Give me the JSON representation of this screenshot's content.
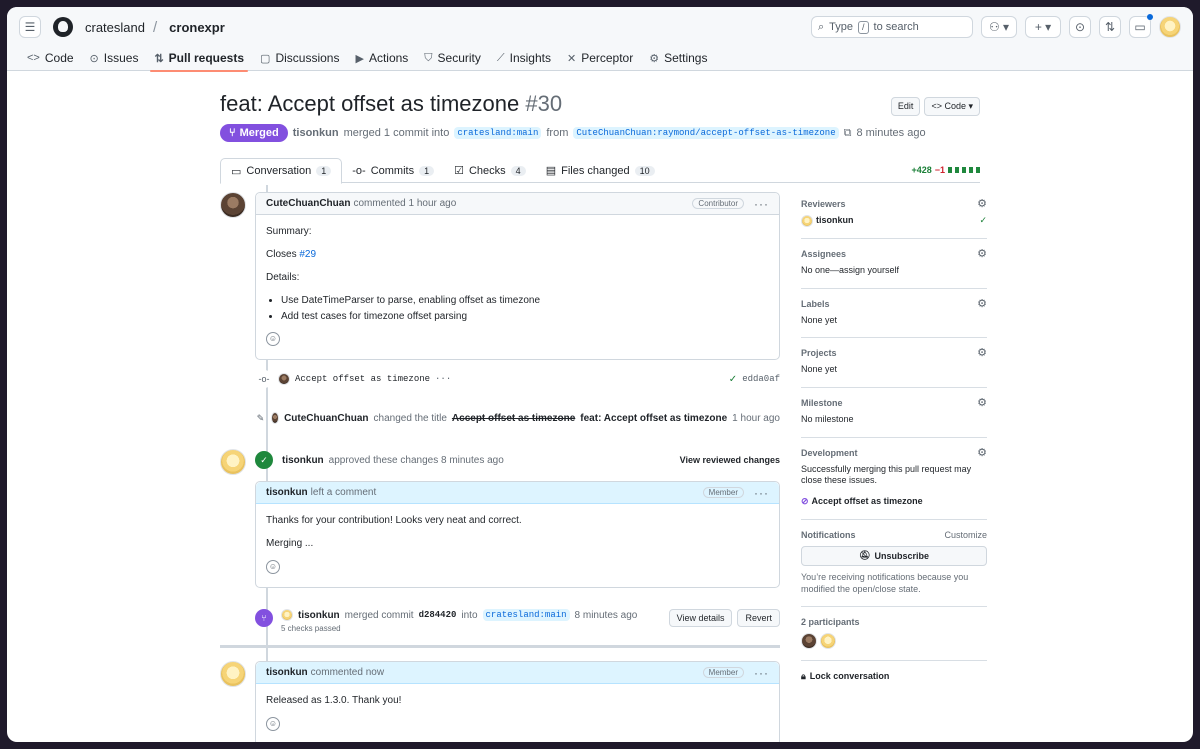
{
  "header": {
    "owner": "cratesland",
    "repo": "cronexpr",
    "search_prefix": "Type",
    "search_key": "/",
    "search_suffix": "to search"
  },
  "repo_tabs": [
    {
      "label": "Code",
      "icon": "code-icon"
    },
    {
      "label": "Issues",
      "icon": "issue-icon"
    },
    {
      "label": "Pull requests",
      "icon": "pull-request-icon",
      "active": true
    },
    {
      "label": "Discussions",
      "icon": "discussion-icon"
    },
    {
      "label": "Actions",
      "icon": "play-icon"
    },
    {
      "label": "Security",
      "icon": "shield-icon"
    },
    {
      "label": "Insights",
      "icon": "graph-icon"
    },
    {
      "label": "Perceptor",
      "icon": "perceptor-icon"
    },
    {
      "label": "Settings",
      "icon": "gear-icon"
    }
  ],
  "pr": {
    "title": "feat: Accept offset as timezone",
    "number": "#30",
    "edit_label": "Edit",
    "code_label": "Code",
    "state": "Merged",
    "merger": "tisonkun",
    "merged_text": "merged 1 commit into",
    "base_branch": "cratesland:main",
    "from_text": "from",
    "head_branch": "CuteChuanChuan:raymond/accept-offset-as-timezone",
    "time": "8 minutes ago"
  },
  "pr_tabs": [
    {
      "label": "Conversation",
      "count": "1",
      "icon": "comment-icon"
    },
    {
      "label": "Commits",
      "count": "1",
      "icon": "commit-icon"
    },
    {
      "label": "Checks",
      "count": "4",
      "icon": "checklist-icon"
    },
    {
      "label": "Files changed",
      "count": "10",
      "icon": "file-diff-icon"
    }
  ],
  "diffstat": {
    "added": "+428",
    "removed": "−1"
  },
  "timeline": {
    "comment1": {
      "author": "CuteChuanChuan",
      "action": "commented 1 hour ago",
      "role": "Contributor",
      "summary": "Summary:",
      "closes_text": "Closes",
      "closes_link": "#29",
      "details": "Details:",
      "bullets": [
        "Use DateTimeParser to parse, enabling offset as timezone",
        "Add test cases for timezone offset parsing"
      ]
    },
    "commit": {
      "message": "Accept offset as timezone",
      "sha": "edda0af"
    },
    "rename": {
      "author": "CuteChuanChuan",
      "action": "changed the title",
      "old": "Accept offset as timezone",
      "new": "feat: Accept offset as timezone",
      "time": "1 hour ago"
    },
    "approval": {
      "author": "tisonkun",
      "action": "approved these changes 8 minutes ago",
      "view": "View reviewed changes"
    },
    "comment2": {
      "author": "tisonkun",
      "action": "left a comment",
      "role": "Member",
      "p1": "Thanks for your contribution! Looks very neat and correct.",
      "p2": "Merging ..."
    },
    "merge": {
      "author": "tisonkun",
      "action": "merged commit",
      "sha": "d284420",
      "into": "into",
      "branch": "cratesland:main",
      "time": "8 minutes ago",
      "checks": "5 checks passed",
      "view_details": "View details",
      "revert": "Revert"
    },
    "comment3": {
      "author": "tisonkun",
      "action": "commented now",
      "role": "Member",
      "body": "Released as 1.3.0. Thank you!"
    }
  },
  "sidebar": {
    "reviewers_title": "Reviewers",
    "reviewer": "tisonkun",
    "assignees_title": "Assignees",
    "assignees_value": "No one—assign yourself",
    "labels_title": "Labels",
    "labels_value": "None yet",
    "projects_title": "Projects",
    "projects_value": "None yet",
    "milestone_title": "Milestone",
    "milestone_value": "No milestone",
    "development_title": "Development",
    "development_text": "Successfully merging this pull request may close these issues.",
    "development_issue": "Accept offset as timezone",
    "notifications_title": "Notifications",
    "customize": "Customize",
    "unsubscribe": "Unsubscribe",
    "notify_reason": "You’re receiving notifications because you modified the open/close state.",
    "participants": "2 participants",
    "lock": "Lock conversation"
  },
  "colors": {
    "merged": "#8250df",
    "accent_tab": "#fd8c73",
    "approve": "#1f883d",
    "link": "#0969da"
  }
}
